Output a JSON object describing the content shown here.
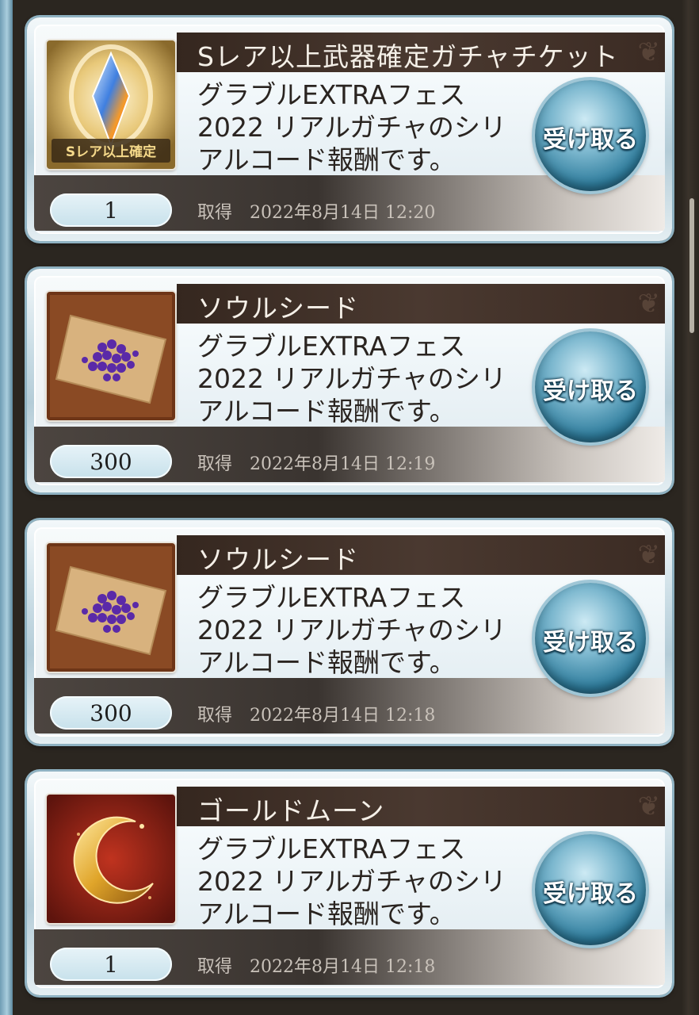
{
  "rewards": [
    {
      "item_name": "Sレア以上武器確定ガチャチケット",
      "description": "グラブルEXTRAフェス2022 リアルガチャのシリアルコード報酬です。",
      "quantity": "1",
      "acquired_label": "取得",
      "acquired_datetime": "2022年8月14日 12:20",
      "receive_label": "受け取る",
      "icon": "gacha-ticket-icon",
      "icon_caption": "Sレア以上確定"
    },
    {
      "item_name": "ソウルシード",
      "description": "グラブルEXTRAフェス2022 リアルガチャのシリアルコード報酬です。",
      "quantity": "300",
      "acquired_label": "取得",
      "acquired_datetime": "2022年8月14日 12:19",
      "receive_label": "受け取る",
      "icon": "soul-seed-icon"
    },
    {
      "item_name": "ソウルシード",
      "description": "グラブルEXTRAフェス2022 リアルガチャのシリアルコード報酬です。",
      "quantity": "300",
      "acquired_label": "取得",
      "acquired_datetime": "2022年8月14日 12:18",
      "receive_label": "受け取る",
      "icon": "soul-seed-icon"
    },
    {
      "item_name": "ゴールドムーン",
      "description": "グラブルEXTRAフェス2022 リアルガチャのシリアルコード報酬です。",
      "quantity": "1",
      "acquired_label": "取得",
      "acquired_datetime": "2022年8月14日 12:18",
      "receive_label": "受け取る",
      "icon": "gold-moon-icon"
    }
  ]
}
